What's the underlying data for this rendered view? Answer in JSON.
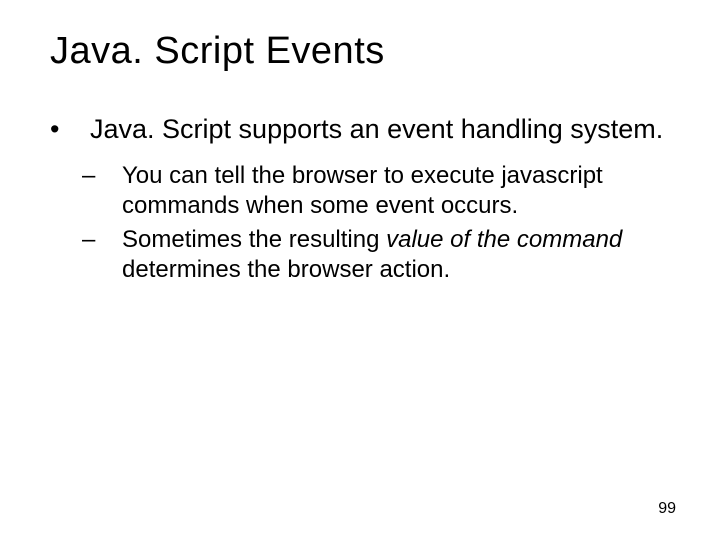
{
  "title": "Java. Script Events",
  "bullet1_prefix": "•",
  "bullet1_text": "Java. Script supports an event handling system.",
  "sub1_prefix": "–",
  "sub1_text": "You can tell the browser to execute javascript commands when some event occurs.",
  "sub2_prefix": "–",
  "sub2_a": "Sometimes the resulting ",
  "sub2_b_italic": "value of the command",
  "sub2_c": " determines the browser action.",
  "page_number": "99"
}
